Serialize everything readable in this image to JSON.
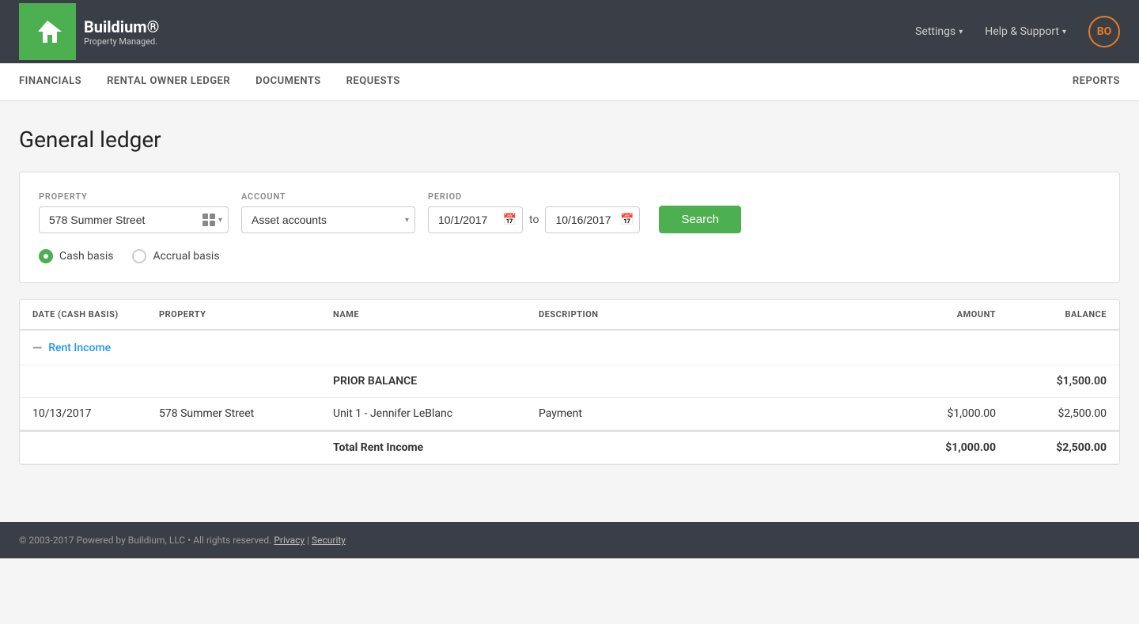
{
  "topNav": {
    "logo": {
      "brand": "Buildium®",
      "tagline": "Property Managed."
    },
    "links": [
      {
        "id": "settings",
        "label": "Settings",
        "hasChevron": true
      },
      {
        "id": "help-support",
        "label": "Help & Support",
        "hasChevron": true
      }
    ],
    "avatar": {
      "initials": "BO"
    }
  },
  "subNav": {
    "leftItems": [
      {
        "id": "financials",
        "label": "FINANCIALS",
        "active": false
      },
      {
        "id": "rental-owner-ledger",
        "label": "RENTAL OWNER LEDGER",
        "active": false
      },
      {
        "id": "documents",
        "label": "DOCUMENTS",
        "active": false
      },
      {
        "id": "requests",
        "label": "REQUESTS",
        "active": false
      }
    ],
    "rightItems": [
      {
        "id": "reports",
        "label": "REPORTS",
        "active": false
      }
    ]
  },
  "page": {
    "title": "General ledger"
  },
  "filters": {
    "propertyLabel": "PROPERTY",
    "propertyValue": "578 Summer Street",
    "accountLabel": "ACCOUNT",
    "accountValue": "Asset accounts",
    "periodLabel": "PERIOD",
    "dateFrom": "10/1/2017",
    "dateTo": "10/16/2017",
    "toLabel": "to",
    "searchButton": "Search",
    "basisOptions": [
      {
        "id": "cash",
        "label": "Cash basis",
        "checked": true
      },
      {
        "id": "accrual",
        "label": "Accrual basis",
        "checked": false
      }
    ]
  },
  "table": {
    "columns": [
      {
        "id": "date",
        "label": "DATE (CASH BASIS)",
        "align": "left"
      },
      {
        "id": "property",
        "label": "PROPERTY",
        "align": "left"
      },
      {
        "id": "name",
        "label": "NAME",
        "align": "left"
      },
      {
        "id": "description",
        "label": "DESCRIPTION",
        "align": "left"
      },
      {
        "id": "amount",
        "label": "AMOUNT",
        "align": "right"
      },
      {
        "id": "balance",
        "label": "BALANCE",
        "align": "right"
      }
    ],
    "sections": [
      {
        "name": "Rent Income",
        "rows": [
          {
            "type": "prior-balance",
            "date": "",
            "property": "",
            "name": "PRIOR BALANCE",
            "description": "",
            "amount": "",
            "balance": "$1,500.00"
          },
          {
            "type": "data",
            "date": "10/13/2017",
            "property": "578 Summer Street",
            "name": "Unit 1 - Jennifer LeBlanc",
            "description": "Payment",
            "amount": "$1,000.00",
            "balance": "$2,500.00"
          }
        ],
        "total": {
          "label": "Total Rent Income",
          "amount": "$1,000.00",
          "balance": "$2,500.00"
        }
      }
    ]
  },
  "footer": {
    "text": "© 2003-2017 Powered by Buildium, LLC • All rights reserved.",
    "links": [
      "Privacy",
      "Security"
    ]
  }
}
